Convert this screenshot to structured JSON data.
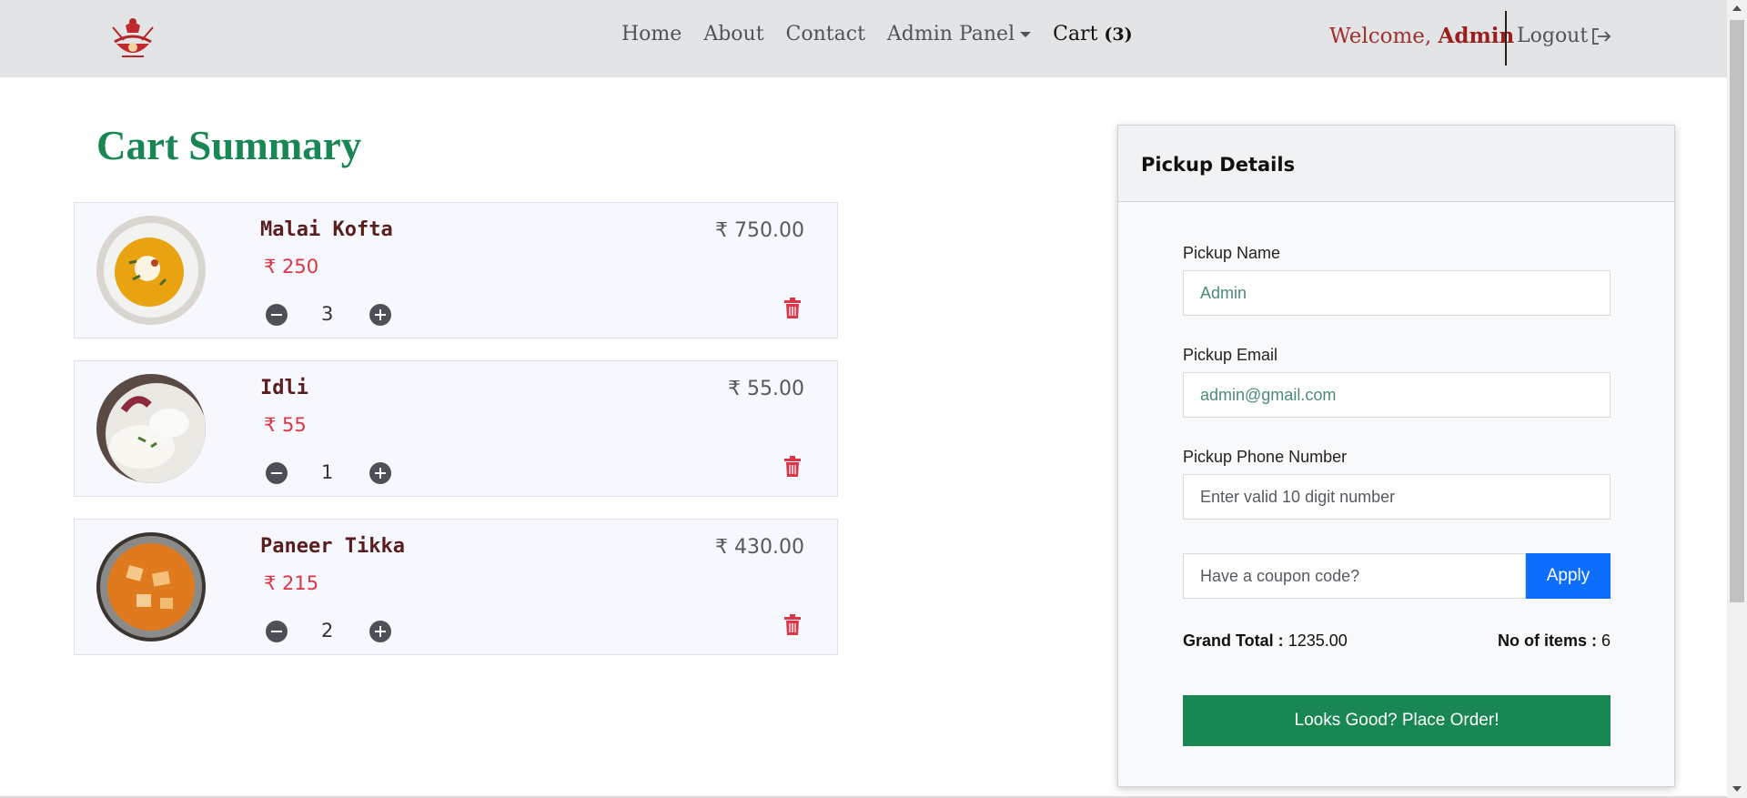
{
  "nav": {
    "logo_icon": "restaurant-logo-icon",
    "links": [
      "Home",
      "About",
      "Contact"
    ],
    "admin_panel": "Admin Panel",
    "cart_label": "Cart",
    "cart_count": "(3)",
    "welcome_prefix": "Welcome,",
    "welcome_user": "Admin",
    "logout": "Logout",
    "logout_icon": "logout-icon"
  },
  "cart": {
    "title": "Cart Summary",
    "items": [
      {
        "name": "Malai Kofta",
        "price": "₹ 250",
        "qty": "3",
        "total": "₹ 750.00",
        "image_icon": "malai-kofta-image"
      },
      {
        "name": "Idli",
        "price": "₹ 55",
        "qty": "1",
        "total": "₹ 55.00",
        "image_icon": "idli-image"
      },
      {
        "name": "Paneer Tikka",
        "price": "₹ 215",
        "qty": "2",
        "total": "₹ 430.00",
        "image_icon": "paneer-tikka-image"
      }
    ]
  },
  "pickup": {
    "header": "Pickup Details",
    "name_label": "Pickup Name",
    "name_value": "Admin",
    "email_label": "Pickup Email",
    "email_value": "admin@gmail.com",
    "phone_label": "Pickup Phone Number",
    "phone_placeholder": "Enter valid 10 digit number",
    "coupon_placeholder": "Have a coupon code?",
    "apply_label": "Apply",
    "grand_total_label": "Grand Total :",
    "grand_total_value": "1235.00",
    "items_label": "No of items :",
    "items_value": "6",
    "place_order_label": "Looks Good? Place Order!"
  },
  "colors": {
    "accent_green": "#198754",
    "price_red": "#dc3545",
    "apply_blue": "#0d6efd",
    "navbar_bg": "#e3e4e6"
  }
}
